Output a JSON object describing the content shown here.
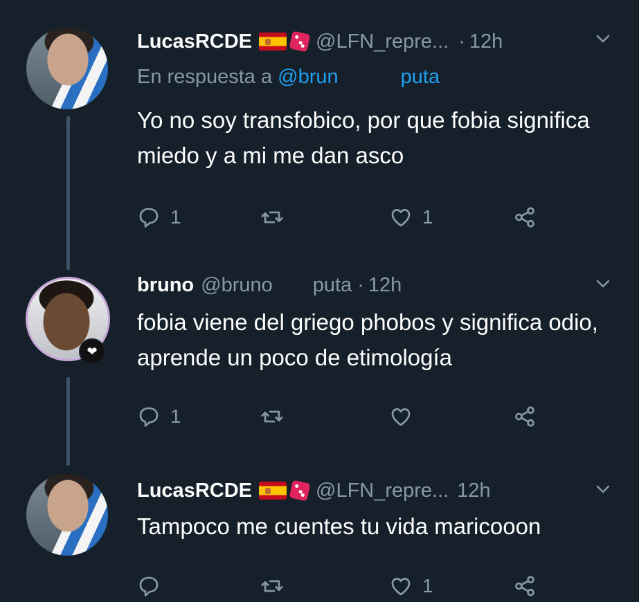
{
  "tweets": [
    {
      "name": "LucasRCDE",
      "handle": "@LFN_repre...",
      "dot": "·",
      "time": "12h",
      "reply_prefix": "En respuesta a",
      "reply_to_start": "@brun",
      "reply_to_end": "puta",
      "text": "Yo no soy transfobico, por que fobia significa miedo y a mi me dan asco",
      "replies": "1",
      "retweets": "",
      "likes": "1"
    },
    {
      "name": "bruno",
      "handle_start": "@bruno",
      "handle_end": "puta",
      "dot": "·",
      "time": "12h",
      "text": "fobia viene del griego phobos y significa odio, aprende un poco de etimología",
      "replies": "1",
      "retweets": "",
      "likes": ""
    },
    {
      "name": "LucasRCDE",
      "handle": "@LFN_repre...",
      "time": "12h",
      "text": "Tampoco me cuentes tu vida maricooon",
      "replies": "",
      "retweets": "",
      "likes": "1"
    }
  ],
  "icons": {
    "flag": "spain-flag-icon",
    "dice": "dice-icon",
    "reply": "reply-icon",
    "retweet": "retweet-icon",
    "like": "heart-icon",
    "share": "share-icon",
    "more": "chevron-down-icon"
  },
  "colors": {
    "background": "#15202b",
    "text": "#ffffff",
    "muted": "#8899a6",
    "link": "#1da1f2",
    "thread_line": "#3d5466"
  }
}
